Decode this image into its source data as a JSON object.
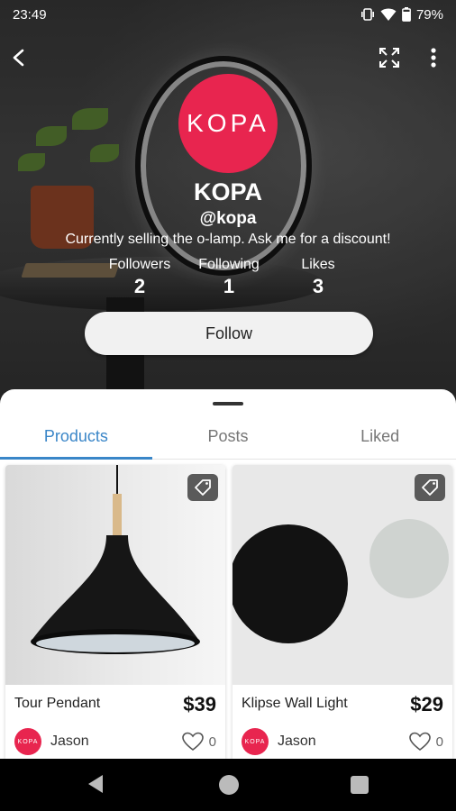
{
  "status_bar": {
    "time": "23:49",
    "battery": "79%"
  },
  "profile": {
    "avatar_text": "KOPA",
    "name": "KOPA",
    "handle": "@kopa",
    "bio": "Currently selling the o-lamp. Ask me for a discount!",
    "stats": [
      {
        "label": "Followers",
        "value": "2"
      },
      {
        "label": "Following",
        "value": "1"
      },
      {
        "label": "Likes",
        "value": "3"
      }
    ],
    "follow_label": "Follow"
  },
  "tabs": [
    {
      "label": "Products",
      "active": true
    },
    {
      "label": "Posts",
      "active": false
    },
    {
      "label": "Liked",
      "active": false
    }
  ],
  "products": [
    {
      "title": "Tour Pendant",
      "price": "$39",
      "seller": "Jason",
      "seller_avatar_text": "KOPA",
      "likes": "0"
    },
    {
      "title": "Klipse Wall Light",
      "price": "$29",
      "seller": "Jason",
      "seller_avatar_text": "KOPA",
      "likes": "0"
    }
  ],
  "colors": {
    "brand": "#e8254f",
    "accent": "#3a86c8"
  },
  "icons": [
    "back-arrow-icon",
    "fullscreen-icon",
    "more-vert-icon",
    "tag-icon",
    "heart-icon"
  ]
}
